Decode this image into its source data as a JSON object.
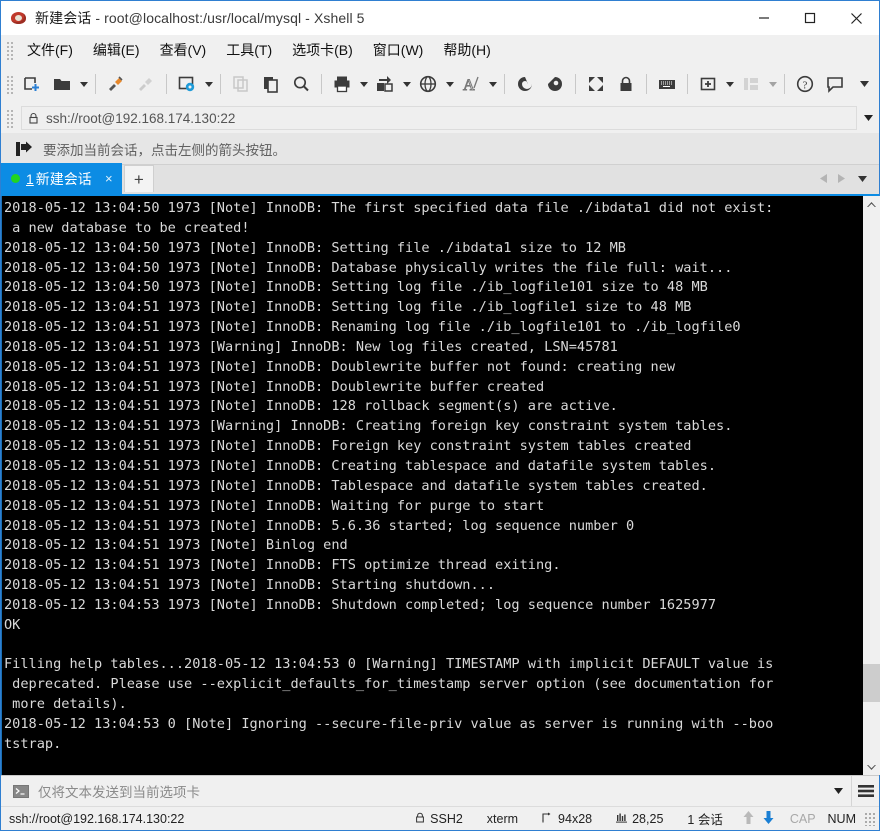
{
  "window": {
    "app_icon": "xshell-icon",
    "title_session": "新建会话",
    "title_rest": " - root@localhost:/usr/local/mysql - Xshell 5",
    "minimize_label": "最小化",
    "maximize_label": "最大化",
    "close_label": "关闭"
  },
  "menubar": {
    "items": [
      {
        "label": "文件(F)",
        "name": "menu-file"
      },
      {
        "label": "编辑(E)",
        "name": "menu-edit"
      },
      {
        "label": "查看(V)",
        "name": "menu-view"
      },
      {
        "label": "工具(T)",
        "name": "menu-tools"
      },
      {
        "label": "选项卡(B)",
        "name": "menu-tabs"
      },
      {
        "label": "窗口(W)",
        "name": "menu-window"
      },
      {
        "label": "帮助(H)",
        "name": "menu-help"
      }
    ]
  },
  "toolbar": {
    "items": [
      {
        "icon": "new-session-icon",
        "caret": false,
        "disabled": false
      },
      {
        "icon": "open-folder-icon",
        "caret": true,
        "disabled": false
      },
      {
        "sep": true
      },
      {
        "icon": "connect-plug-icon",
        "caret": false,
        "disabled": false
      },
      {
        "icon": "disconnect-plug-icon",
        "caret": false,
        "disabled": true
      },
      {
        "sep": true
      },
      {
        "icon": "session-properties-icon",
        "caret": true,
        "disabled": false
      },
      {
        "sep": true
      },
      {
        "icon": "copy-icon",
        "caret": false,
        "disabled": true
      },
      {
        "icon": "paste-icon",
        "caret": false,
        "disabled": false
      },
      {
        "icon": "find-icon",
        "caret": false,
        "disabled": false
      },
      {
        "sep": true
      },
      {
        "icon": "print-icon",
        "caret": true,
        "disabled": false
      },
      {
        "icon": "file-transfer-icon",
        "caret": true,
        "disabled": false
      },
      {
        "icon": "globe-icon",
        "caret": true,
        "disabled": false
      },
      {
        "icon": "font-size-icon",
        "caret": true,
        "disabled": false
      },
      {
        "sep": true
      },
      {
        "icon": "xshell-log-icon",
        "caret": false,
        "disabled": false
      },
      {
        "icon": "xftp-icon",
        "caret": false,
        "disabled": false
      },
      {
        "sep": true
      },
      {
        "icon": "fullscreen-icon",
        "caret": false,
        "disabled": false
      },
      {
        "icon": "lock-icon",
        "caret": false,
        "disabled": false
      },
      {
        "sep": true
      },
      {
        "icon": "keyboard-icon",
        "caret": false,
        "disabled": false
      },
      {
        "sep": true
      },
      {
        "icon": "add-to-folder-icon",
        "caret": true,
        "disabled": false
      },
      {
        "icon": "layout-icon",
        "caret": true,
        "disabled": true
      },
      {
        "sep": true
      },
      {
        "icon": "help-icon",
        "caret": false,
        "disabled": false
      },
      {
        "icon": "feedback-icon",
        "caret": false,
        "disabled": false
      }
    ],
    "overflow_icon": "chevron-down-icon"
  },
  "address": {
    "lock_icon": "lock-icon",
    "value": "ssh://root@192.168.174.130:22",
    "dropdown_icon": "chevron-down-icon"
  },
  "hint": {
    "icon": "add-session-arrow-icon",
    "text": "要添加当前会话，点击左侧的箭头按钮。"
  },
  "tabbar": {
    "tabs": [
      {
        "index": "1",
        "label": "新建会话",
        "status": "connected",
        "close_label": "×"
      }
    ],
    "new_tab_label": "+",
    "prev_icon": "triangle-left-icon",
    "next_icon": "triangle-right-icon",
    "list_icon": "chevron-down-icon"
  },
  "terminal": {
    "lines": [
      "2018-05-12 13:04:50 1973 [Note] InnoDB: The first specified data file ./ibdata1 did not exist:",
      " a new database to be created!",
      "2018-05-12 13:04:50 1973 [Note] InnoDB: Setting file ./ibdata1 size to 12 MB",
      "2018-05-12 13:04:50 1973 [Note] InnoDB: Database physically writes the file full: wait...",
      "2018-05-12 13:04:50 1973 [Note] InnoDB: Setting log file ./ib_logfile101 size to 48 MB",
      "2018-05-12 13:04:51 1973 [Note] InnoDB: Setting log file ./ib_logfile1 size to 48 MB",
      "2018-05-12 13:04:51 1973 [Note] InnoDB: Renaming log file ./ib_logfile101 to ./ib_logfile0",
      "2018-05-12 13:04:51 1973 [Warning] InnoDB: New log files created, LSN=45781",
      "2018-05-12 13:04:51 1973 [Note] InnoDB: Doublewrite buffer not found: creating new",
      "2018-05-12 13:04:51 1973 [Note] InnoDB: Doublewrite buffer created",
      "2018-05-12 13:04:51 1973 [Note] InnoDB: 128 rollback segment(s) are active.",
      "2018-05-12 13:04:51 1973 [Warning] InnoDB: Creating foreign key constraint system tables.",
      "2018-05-12 13:04:51 1973 [Note] InnoDB: Foreign key constraint system tables created",
      "2018-05-12 13:04:51 1973 [Note] InnoDB: Creating tablespace and datafile system tables.",
      "2018-05-12 13:04:51 1973 [Note] InnoDB: Tablespace and datafile system tables created.",
      "2018-05-12 13:04:51 1973 [Note] InnoDB: Waiting for purge to start",
      "2018-05-12 13:04:51 1973 [Note] InnoDB: 5.6.36 started; log sequence number 0",
      "2018-05-12 13:04:51 1973 [Note] Binlog end",
      "2018-05-12 13:04:51 1973 [Note] InnoDB: FTS optimize thread exiting.",
      "2018-05-12 13:04:51 1973 [Note] InnoDB: Starting shutdown...",
      "2018-05-12 13:04:53 1973 [Note] InnoDB: Shutdown completed; log sequence number 1625977",
      "OK",
      "",
      "Filling help tables...2018-05-12 13:04:53 0 [Warning] TIMESTAMP with implicit DEFAULT value is",
      " deprecated. Please use --explicit_defaults_for_timestamp server option (see documentation for",
      " more details).",
      "2018-05-12 13:04:53 0 [Note] Ignoring --secure-file-priv value as server is running with --boo",
      "tstrap."
    ],
    "fg_color": "#d9d9d9",
    "bg_color": "#000000"
  },
  "scrollbar": {
    "up_icon": "chevron-up-icon",
    "down_icon": "chevron-down-icon"
  },
  "sendbar": {
    "icon": "terminal-prompt-icon",
    "text": "仅将文本发送到当前选项卡",
    "dropdown_icon": "chevron-down-icon",
    "menu_icon": "hamburger-menu-icon"
  },
  "statusbar": {
    "connection": "ssh://root@192.168.174.130:22",
    "protocol_icon": "lock-icon",
    "protocol": "SSH2",
    "term_type": "xterm",
    "size_icon": "resize-icon",
    "size": "94x28",
    "cursor_icon": "cursor-pos-icon",
    "cursor": "28,25",
    "sessions": "1 会话",
    "upload_icon": "arrow-up-icon",
    "download_icon": "arrow-down-icon",
    "caps": "CAP",
    "num": "NUM"
  },
  "colors": {
    "accent": "#0c8ce4",
    "window_border": "#2f7fd1",
    "chrome": "#f0f0f0",
    "terminal_bg": "#000000",
    "terminal_fg": "#d9d9d9",
    "tab_active_bg": "#0c8ce4",
    "status_dot": "#21d421"
  }
}
